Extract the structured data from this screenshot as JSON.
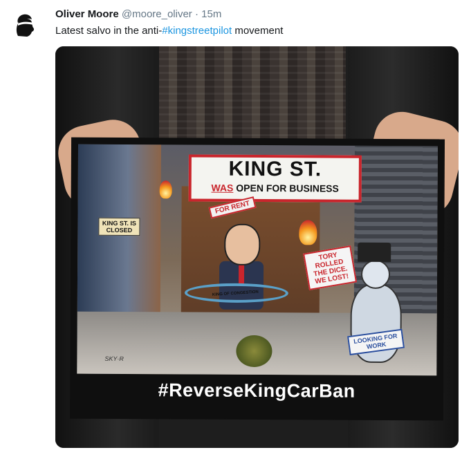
{
  "tweet": {
    "author": {
      "display_name": "Oliver Moore",
      "handle": "@moore_oliver",
      "separator": "·",
      "time": "15m",
      "avatar_icon": "moor-head-bandana-avatar"
    },
    "text": {
      "prefix": "Latest salvo in the anti-",
      "hashtag": "#kingstreetpilot",
      "suffix": " movement"
    },
    "colors": {
      "hashtag": "#1b95e0",
      "name": "#14171a",
      "meta": "#657786"
    },
    "media": {
      "poster": {
        "sign_main_title": "KING ST.",
        "sign_main_was": "WAS",
        "sign_main_rest": " OPEN FOR BUSINESS",
        "sign_closed": "KING ST. IS CLOSED",
        "sign_rent": "FOR RENT",
        "sign_tory": "TORY ROLLED THE DICE. WE LOST!",
        "hoop_label": "KING OF CONGESTION",
        "sign_looking": "LOOKING FOR WORK",
        "signature": "SKY·R",
        "caption": "#ReverseKingCarBan"
      }
    }
  }
}
